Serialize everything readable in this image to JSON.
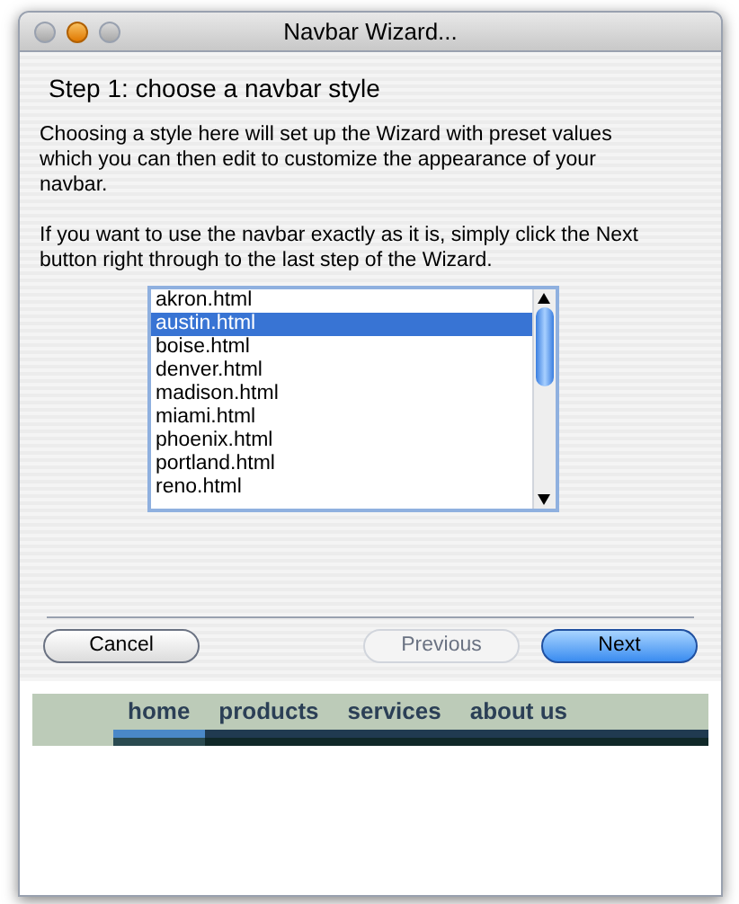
{
  "window": {
    "title": "Navbar Wizard..."
  },
  "heading": "Step 1: choose a navbar style",
  "paragraphs": [
    "Choosing a style here will set up the Wizard with preset values which you can then edit to customize the appearance of your navbar.",
    "If you want to use the navbar exactly as it is, simply click the Next button right through to the last step of the Wizard."
  ],
  "styles": [
    {
      "label": "akron.html",
      "selected": false
    },
    {
      "label": "austin.html",
      "selected": true
    },
    {
      "label": "boise.html",
      "selected": false
    },
    {
      "label": "denver.html",
      "selected": false
    },
    {
      "label": "madison.html",
      "selected": false
    },
    {
      "label": "miami.html",
      "selected": false
    },
    {
      "label": "phoenix.html",
      "selected": false
    },
    {
      "label": "portland.html",
      "selected": false
    },
    {
      "label": "reno.html",
      "selected": false
    }
  ],
  "buttons": [
    {
      "label": "Cancel",
      "kind": "plain",
      "disabled": false
    },
    {
      "label": "Previous",
      "kind": "plain",
      "disabled": true
    },
    {
      "label": "Next",
      "kind": "default",
      "disabled": false
    }
  ],
  "preview": {
    "items": [
      {
        "label": "home",
        "selected": true
      },
      {
        "label": "products",
        "selected": false
      },
      {
        "label": "services",
        "selected": false
      },
      {
        "label": "about us",
        "selected": false
      }
    ]
  }
}
